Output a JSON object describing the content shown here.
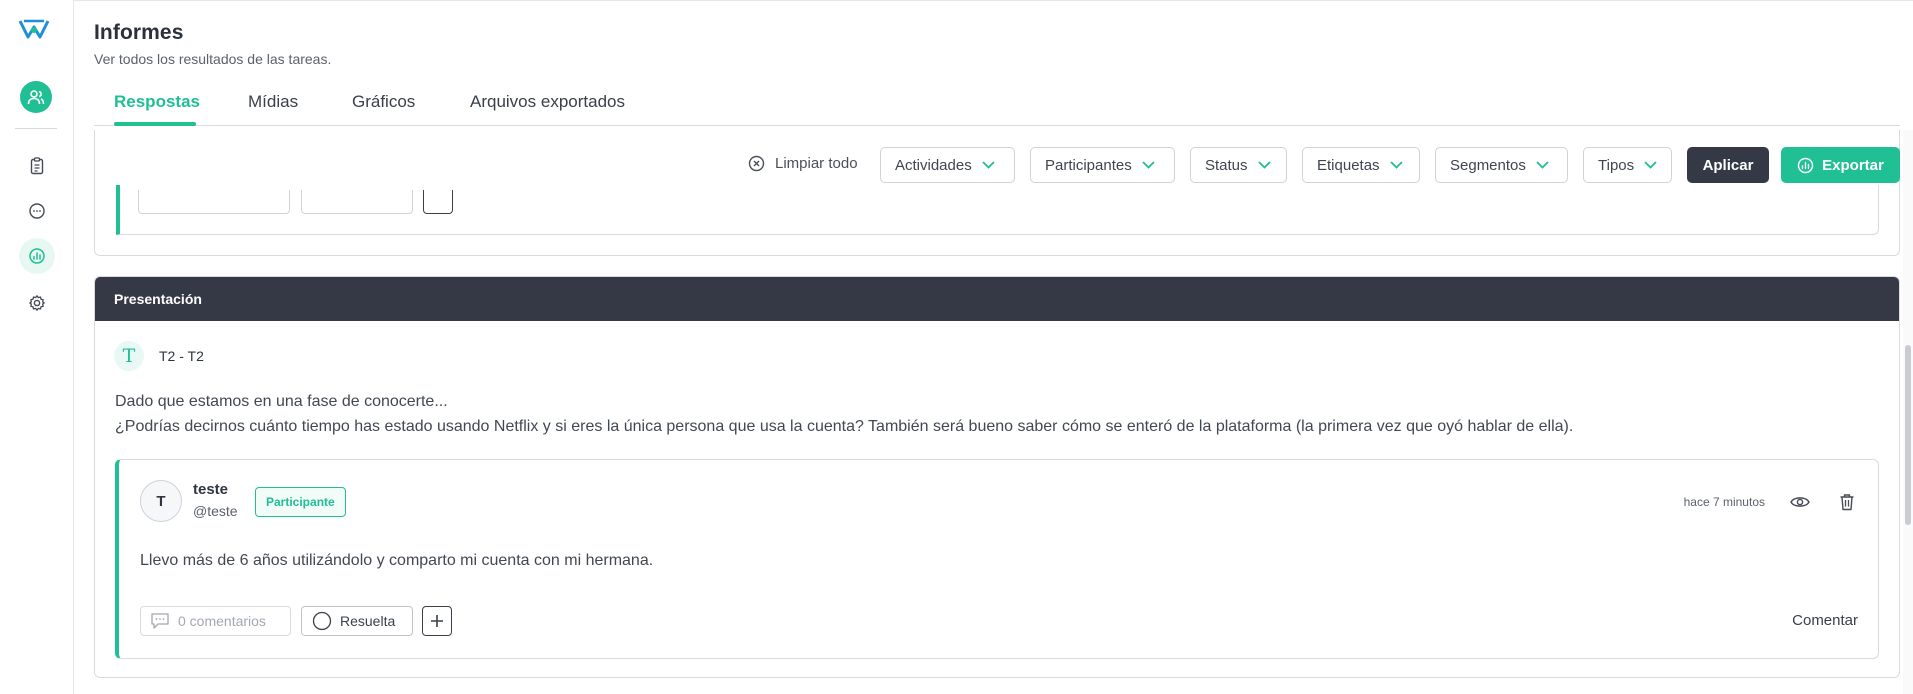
{
  "header": {
    "title": "Informes",
    "subtitle": "Ver todos los resultados de las tareas."
  },
  "tabs": [
    {
      "label": "Respostas",
      "active": true
    },
    {
      "label": "Mídias",
      "active": false
    },
    {
      "label": "Gráficos",
      "active": false
    },
    {
      "label": "Arquivos exportados",
      "active": false
    }
  ],
  "filters": {
    "clear_all": "Limpiar todo",
    "items": [
      "Actividades",
      "Participantes",
      "Status",
      "Etiquetas",
      "Segmentos",
      "Tipos"
    ],
    "apply": "Aplicar",
    "export": "Exportar"
  },
  "section": {
    "title": "Presentación",
    "question_code": "T2 - T2",
    "question_type_icon": "T",
    "question_line1": "Dado que estamos en una fase de conocerte...",
    "question_line2": "¿Podrías decirnos cuánto tiempo has estado usando Netflix y si eres la única persona que usa la cuenta? También será bueno saber cómo se enteró de la plataforma (la primera vez que oyó hablar de ella).",
    "answer": {
      "avatar_initial": "T",
      "name": "teste",
      "handle": "@teste",
      "badge": "Participante",
      "time": "hace 7 minutos",
      "text": "Llevo más de 6 años utilizándolo y comparto mi cuenta con mi hermana.",
      "comments_label": "0 comentarios",
      "resolved_label": "Resuelta",
      "comment_action": "Comentar"
    }
  },
  "colors": {
    "accent": "#20bf94",
    "dark": "#353945",
    "border": "#d9dbdf"
  }
}
